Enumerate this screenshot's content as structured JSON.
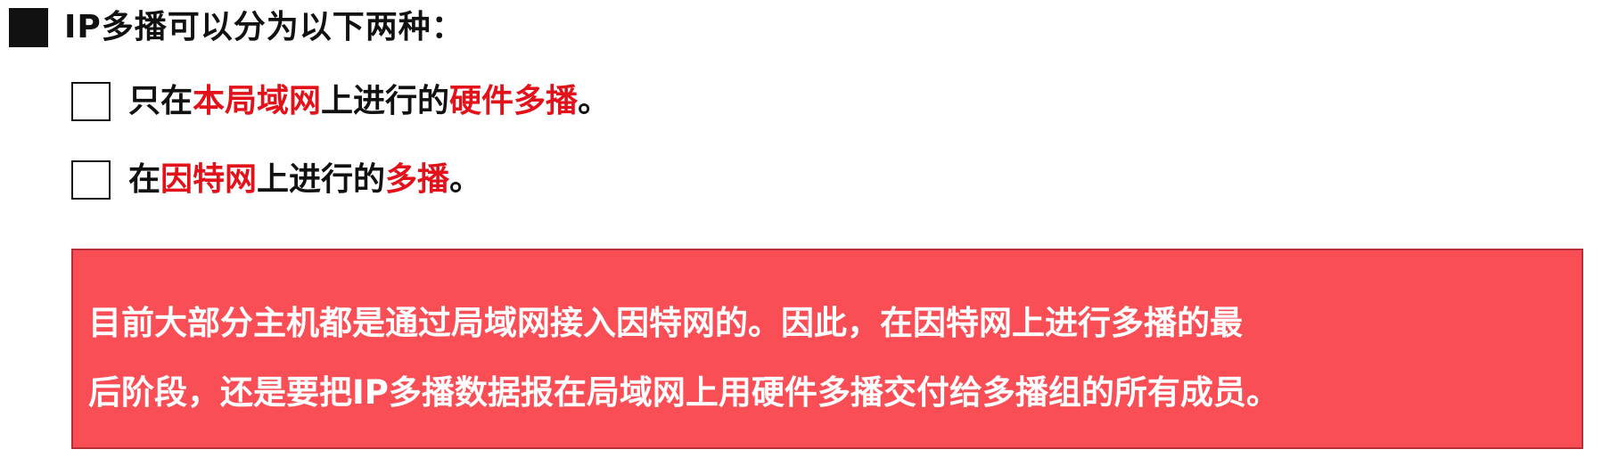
{
  "heading": {
    "icon": "filled-square-bullet-icon",
    "text": "IP多播可以分为以下两种："
  },
  "bullets": [
    {
      "icon": "empty-square-bullet-icon",
      "parts": [
        "只在",
        "本局域网",
        "上进行的",
        "硬件多播",
        "。"
      ]
    },
    {
      "icon": "empty-square-bullet-icon",
      "parts": [
        "在",
        "因特网",
        "上进行的",
        "多播",
        "。"
      ]
    }
  ],
  "note": {
    "lines": [
      "目前大部分主机都是通过局域网接入因特网的。因此，在因特网上进行多播的最",
      "后阶段，还是要把IP多播数据报在局域网上用硬件多播交付给多播组的所有成员。"
    ]
  },
  "colors": {
    "text": "#111111",
    "highlight": "#e3111a",
    "note_background": "#fa4e57",
    "note_border": "#b73038",
    "note_text": "#ffffff"
  }
}
